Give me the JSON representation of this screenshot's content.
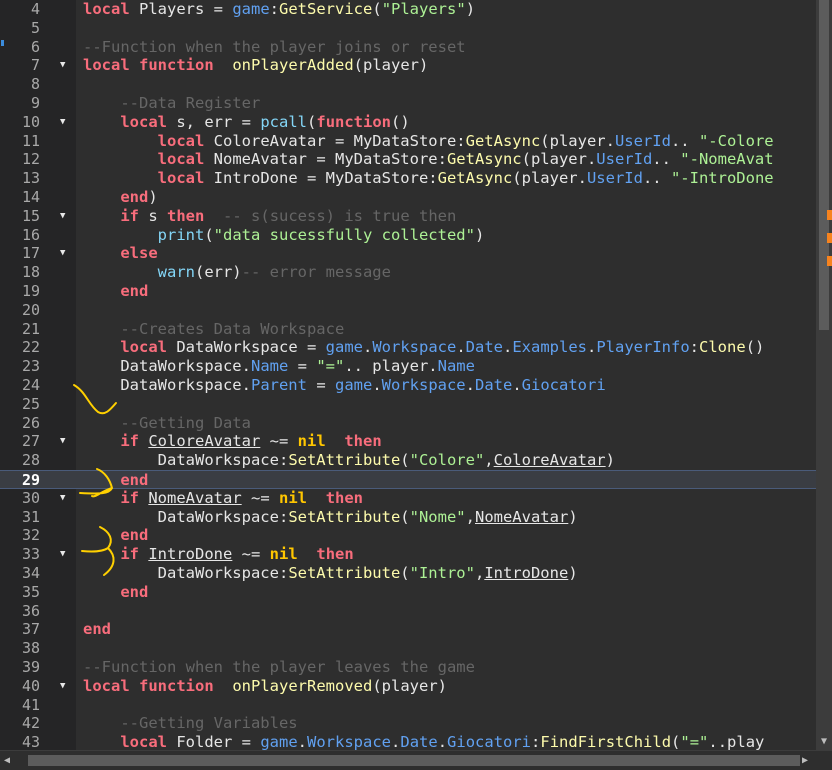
{
  "editor": {
    "current_line": "29",
    "rows": [
      {
        "num": "4",
        "fold": false,
        "t": [
          [
            "kw",
            "local"
          ],
          [
            "",
            "Players = "
          ],
          [
            "prop",
            "game"
          ],
          [
            "",
            ":"
          ],
          [
            "mth",
            "GetService"
          ],
          [
            "",
            "("
          ],
          [
            "str",
            "\"Players\""
          ],
          [
            "",
            ")"
          ]
        ]
      },
      {
        "num": "5",
        "fold": false,
        "t": []
      },
      {
        "num": "6",
        "fold": false,
        "t": [
          [
            "cm",
            "--Function when the player joins or reset"
          ]
        ]
      },
      {
        "num": "7",
        "fold": true,
        "t": [
          [
            "kw",
            "local function"
          ],
          [
            "",
            ""
          ],
          [
            "mth",
            "onPlayerAdded"
          ],
          [
            "",
            "(player)"
          ]
        ]
      },
      {
        "num": "8",
        "fold": false,
        "t": []
      },
      {
        "num": "9",
        "fold": false,
        "t": [
          [
            "",
            "    "
          ],
          [
            "cm",
            "--Data Register"
          ]
        ]
      },
      {
        "num": "10",
        "fold": true,
        "t": [
          [
            "",
            "    "
          ],
          [
            "kw",
            "local"
          ],
          [
            "",
            "s, err = "
          ],
          [
            "bi",
            "pcall"
          ],
          [
            "",
            "("
          ],
          [
            "kw",
            "function"
          ],
          [
            "",
            "()"
          ]
        ]
      },
      {
        "num": "11",
        "fold": false,
        "t": [
          [
            "",
            "        "
          ],
          [
            "kw",
            "local"
          ],
          [
            "",
            "ColoreAvatar = MyDataStore:"
          ],
          [
            "mth",
            "GetAsync"
          ],
          [
            "",
            "(player."
          ],
          [
            "prop",
            "UserId"
          ],
          [
            "",
            ".. "
          ],
          [
            "str",
            "\"-Colore"
          ]
        ]
      },
      {
        "num": "12",
        "fold": false,
        "t": [
          [
            "",
            "        "
          ],
          [
            "kw",
            "local"
          ],
          [
            "",
            "NomeAvatar = MyDataStore:"
          ],
          [
            "mth",
            "GetAsync"
          ],
          [
            "",
            "(player."
          ],
          [
            "prop",
            "UserId"
          ],
          [
            "",
            ".. "
          ],
          [
            "str",
            "\"-NomeAvat"
          ]
        ]
      },
      {
        "num": "13",
        "fold": false,
        "t": [
          [
            "",
            "        "
          ],
          [
            "kw",
            "local"
          ],
          [
            "",
            "IntroDone = MyDataStore:"
          ],
          [
            "mth",
            "GetAsync"
          ],
          [
            "",
            "(player."
          ],
          [
            "prop",
            "UserId"
          ],
          [
            "",
            ".. "
          ],
          [
            "str",
            "\"-IntroDone"
          ]
        ]
      },
      {
        "num": "14",
        "fold": false,
        "t": [
          [
            "",
            "    "
          ],
          [
            "kw",
            "end"
          ],
          [
            "",
            ")"
          ]
        ]
      },
      {
        "num": "15",
        "fold": true,
        "t": [
          [
            "",
            "    "
          ],
          [
            "kw",
            "if"
          ],
          [
            "",
            "s "
          ],
          [
            "kw",
            "then"
          ],
          [
            "",
            ""
          ],
          [
            "cm",
            "-- s(sucess) is true then"
          ]
        ]
      },
      {
        "num": "16",
        "fold": false,
        "t": [
          [
            "",
            "        "
          ],
          [
            "bi",
            "print"
          ],
          [
            "",
            "("
          ],
          [
            "str",
            "\"data sucessfully collected\""
          ],
          [
            "",
            ")"
          ]
        ]
      },
      {
        "num": "17",
        "fold": true,
        "t": [
          [
            "",
            "    "
          ],
          [
            "kw",
            "else"
          ]
        ]
      },
      {
        "num": "18",
        "fold": false,
        "t": [
          [
            "",
            "        "
          ],
          [
            "bi",
            "warn"
          ],
          [
            "",
            "(err)"
          ],
          [
            "cm",
            "-- error message"
          ]
        ]
      },
      {
        "num": "19",
        "fold": false,
        "t": [
          [
            "",
            "    "
          ],
          [
            "kw",
            "end"
          ]
        ]
      },
      {
        "num": "20",
        "fold": false,
        "t": []
      },
      {
        "num": "21",
        "fold": false,
        "t": [
          [
            "",
            "    "
          ],
          [
            "cm",
            "--Creates Data Workspace"
          ]
        ]
      },
      {
        "num": "22",
        "fold": false,
        "t": [
          [
            "",
            "    "
          ],
          [
            "kw",
            "local"
          ],
          [
            "",
            "DataWorkspace = "
          ],
          [
            "prop",
            "game"
          ],
          [
            "",
            "."
          ],
          [
            "prop",
            "Workspace"
          ],
          [
            "",
            "."
          ],
          [
            "prop",
            "Date"
          ],
          [
            "",
            "."
          ],
          [
            "prop",
            "Examples"
          ],
          [
            "",
            "."
          ],
          [
            "prop",
            "PlayerInfo"
          ],
          [
            "",
            ":"
          ],
          [
            "mth",
            "Clone"
          ],
          [
            "",
            "()"
          ]
        ]
      },
      {
        "num": "23",
        "fold": false,
        "t": [
          [
            "",
            "    DataWorkspace."
          ],
          [
            "prop",
            "Name"
          ],
          [
            "",
            ""
          ],
          [
            "str",
            "\"=\""
          ],
          [
            "",
            ".. player."
          ],
          [
            "prop",
            "Name"
          ]
        ]
      },
      {
        "num": "24",
        "fold": false,
        "t": [
          [
            "",
            "    DataWorkspace."
          ],
          [
            "prop",
            "Parent"
          ],
          [
            "",
            ""
          ],
          [
            "prop",
            "game"
          ],
          [
            "",
            "."
          ],
          [
            "prop",
            "Workspace"
          ],
          [
            "",
            "."
          ],
          [
            "prop",
            "Date"
          ],
          [
            "",
            "."
          ],
          [
            "prop",
            "Giocatori"
          ]
        ]
      },
      {
        "num": "25",
        "fold": false,
        "t": []
      },
      {
        "num": "26",
        "fold": false,
        "t": [
          [
            "",
            "    "
          ],
          [
            "cm",
            "--Getting Data"
          ]
        ]
      },
      {
        "num": "27",
        "fold": true,
        "t": [
          [
            "",
            "    "
          ],
          [
            "kw",
            "if"
          ],
          [
            "ul",
            "ColoreAvatar"
          ],
          [
            "",
            ""
          ],
          [
            "kw2",
            "nil"
          ],
          [
            "",
            ""
          ],
          [
            "kw",
            "then"
          ]
        ]
      },
      {
        "num": "28",
        "fold": false,
        "t": [
          [
            "",
            "        DataWorkspace:"
          ],
          [
            "mth",
            "SetAttribute"
          ],
          [
            "",
            "("
          ],
          [
            "str",
            "\"Colore\""
          ],
          [
            "",
            ","
          ],
          [
            "ul",
            "ColoreAvatar"
          ],
          [
            "",
            ")"
          ]
        ]
      },
      {
        "num": "29",
        "fold": false,
        "t": [
          [
            "",
            "    "
          ],
          [
            "kw",
            "end"
          ]
        ]
      },
      {
        "num": "30",
        "fold": true,
        "t": [
          [
            "",
            "    "
          ],
          [
            "kw",
            "if"
          ],
          [
            "ul",
            "NomeAvatar"
          ],
          [
            "",
            ""
          ],
          [
            "kw2",
            "nil"
          ],
          [
            "",
            ""
          ],
          [
            "kw",
            "then"
          ]
        ]
      },
      {
        "num": "31",
        "fold": false,
        "t": [
          [
            "",
            "        DataWorkspace:"
          ],
          [
            "mth",
            "SetAttribute"
          ],
          [
            "",
            "("
          ],
          [
            "str",
            "\"Nome\""
          ],
          [
            "",
            ","
          ],
          [
            "ul",
            "NomeAvatar"
          ],
          [
            "",
            ")"
          ]
        ]
      },
      {
        "num": "32",
        "fold": false,
        "t": [
          [
            "",
            "    "
          ],
          [
            "kw",
            "end"
          ]
        ]
      },
      {
        "num": "33",
        "fold": true,
        "t": [
          [
            "",
            "    "
          ],
          [
            "kw",
            "if"
          ],
          [
            "ul",
            "IntroDone"
          ],
          [
            "",
            ""
          ],
          [
            "kw2",
            "nil"
          ],
          [
            "",
            ""
          ],
          [
            "kw",
            "then"
          ]
        ]
      },
      {
        "num": "34",
        "fold": false,
        "t": [
          [
            "",
            "        DataWorkspace:"
          ],
          [
            "mth",
            "SetAttribute"
          ],
          [
            "",
            "("
          ],
          [
            "str",
            "\"Intro\""
          ],
          [
            "",
            ","
          ],
          [
            "ul",
            "IntroDone"
          ],
          [
            "",
            ")"
          ]
        ]
      },
      {
        "num": "35",
        "fold": false,
        "t": [
          [
            "",
            "    "
          ],
          [
            "kw",
            "end"
          ]
        ]
      },
      {
        "num": "36",
        "fold": false,
        "t": []
      },
      {
        "num": "37",
        "fold": false,
        "t": [
          [
            "kw",
            "end"
          ]
        ]
      },
      {
        "num": "38",
        "fold": false,
        "t": []
      },
      {
        "num": "39",
        "fold": false,
        "t": [
          [
            "cm",
            "--Function when the player leaves the game"
          ]
        ]
      },
      {
        "num": "40",
        "fold": true,
        "t": [
          [
            "kw",
            "local function"
          ],
          [
            "",
            ""
          ],
          [
            "mth",
            "onPlayerRemoved"
          ],
          [
            "",
            "(player)"
          ]
        ]
      },
      {
        "num": "41",
        "fold": false,
        "t": []
      },
      {
        "num": "42",
        "fold": false,
        "t": [
          [
            "",
            "    "
          ],
          [
            "cm",
            "--Getting Variables"
          ]
        ]
      },
      {
        "num": "43",
        "fold": false,
        "t": [
          [
            "",
            "    "
          ],
          [
            "kw",
            "local"
          ],
          [
            "",
            "Folder = "
          ],
          [
            "prop",
            "game"
          ],
          [
            "",
            "."
          ],
          [
            "prop",
            "Workspace"
          ],
          [
            "",
            "."
          ],
          [
            "prop",
            "Date"
          ],
          [
            "",
            "."
          ],
          [
            "prop",
            "Giocatori"
          ],
          [
            "",
            ":"
          ],
          [
            "mth",
            "FindFirstChild"
          ],
          [
            "",
            "("
          ],
          [
            "str",
            "\"=\""
          ],
          [
            "",
            ".."
          ],
          [
            "",
            "play"
          ]
        ]
      }
    ]
  },
  "scrollbar": {
    "up_arrow": "▲",
    "down_arrow": "▼",
    "left_arrow": "◀",
    "right_arrow": "▶"
  },
  "annotation_color": "#ffd000"
}
